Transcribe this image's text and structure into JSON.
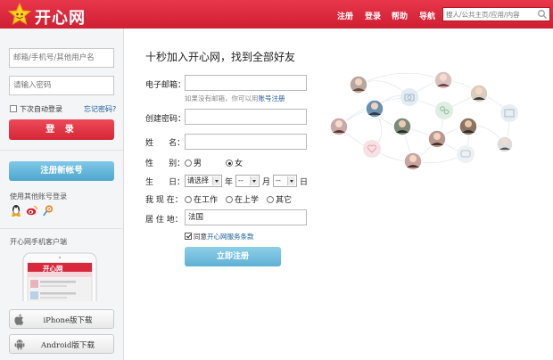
{
  "header": {
    "logo_text": "开心网",
    "nav": [
      "注册",
      "登录",
      "帮助",
      "导航"
    ],
    "search_placeholder": "搜人/公共主页/应用/内容",
    "colors": {
      "brand": "#d8283c"
    }
  },
  "login": {
    "account_placeholder": "邮箱/手机号/其他用户名",
    "password_placeholder": "请输入密码",
    "auto_login": "下次自动登录",
    "forgot": "忘记密码?",
    "login_button": "登 录",
    "register_button": "注册新帐号",
    "other_login": "使用其他账号登录",
    "social_icons": [
      "qq-icon",
      "weibo-icon",
      "tencent-weibo-icon"
    ],
    "mobile_title": "开心网手机客户端",
    "phone_app_title": "开心网",
    "downloads": [
      {
        "label": "iPhone版下载",
        "icon": "apple-icon"
      },
      {
        "label": "Android版下载",
        "icon": "android-icon"
      }
    ]
  },
  "form": {
    "title": "十秒加入开心网，找到全部好友",
    "email_label": "电子邮箱：",
    "email_hint_prefix": "如果没有邮箱，你可以用",
    "email_hint_link": "账号注册",
    "password_label": "创建密码：",
    "name_label": "姓      名：",
    "gender_label": "性      别：",
    "gender_options": [
      "男",
      "女"
    ],
    "gender_selected": "女",
    "birthday_label": "生      日：",
    "birthday_year": "请选择",
    "birthday_month": "--",
    "birthday_day": "--",
    "unit_year": "年",
    "unit_month": "月",
    "unit_day": "日",
    "status_label": "我 现 在：",
    "status_options": [
      "在工作",
      "在上学",
      "其它"
    ],
    "residence_label": "居 住 地：",
    "residence_value": "法国",
    "agree_prefix": "同意",
    "agree_link": "开心网服务条款",
    "agree_checked": true,
    "submit": "立即注册"
  }
}
